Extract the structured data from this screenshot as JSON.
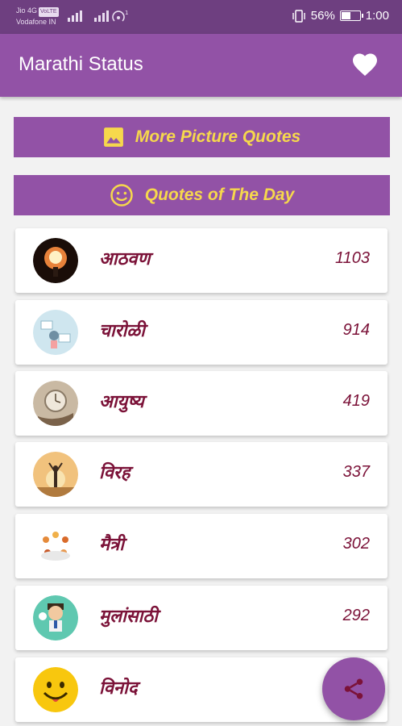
{
  "status_bar": {
    "carrier_1": "Jio 4G",
    "carrier_1_tag": "VoLTE",
    "carrier_2": "Vodafone IN",
    "battery_percent": "56%",
    "battery_level": 0.56,
    "time": "1:00"
  },
  "appbar": {
    "title": "Marathi Status"
  },
  "banners": [
    {
      "label": "More Picture Quotes",
      "icon": "image-icon"
    },
    {
      "label": "Quotes of The Day",
      "icon": "smiley-icon"
    }
  ],
  "categories": [
    {
      "name": "आठवण",
      "count": "1103"
    },
    {
      "name": "चारोळी",
      "count": "914"
    },
    {
      "name": "आयुष्य",
      "count": "419"
    },
    {
      "name": "विरह",
      "count": "337"
    },
    {
      "name": "मैत्री",
      "count": "302"
    },
    {
      "name": "मुलांसाठी",
      "count": "292"
    },
    {
      "name": "विनोद",
      "count": ""
    }
  ],
  "colors": {
    "status_bar": "#6e3f80",
    "primary": "#9252a6",
    "banner_text": "#f6d84c",
    "category_text": "#7b1238"
  },
  "fab": {
    "icon": "share-icon"
  }
}
